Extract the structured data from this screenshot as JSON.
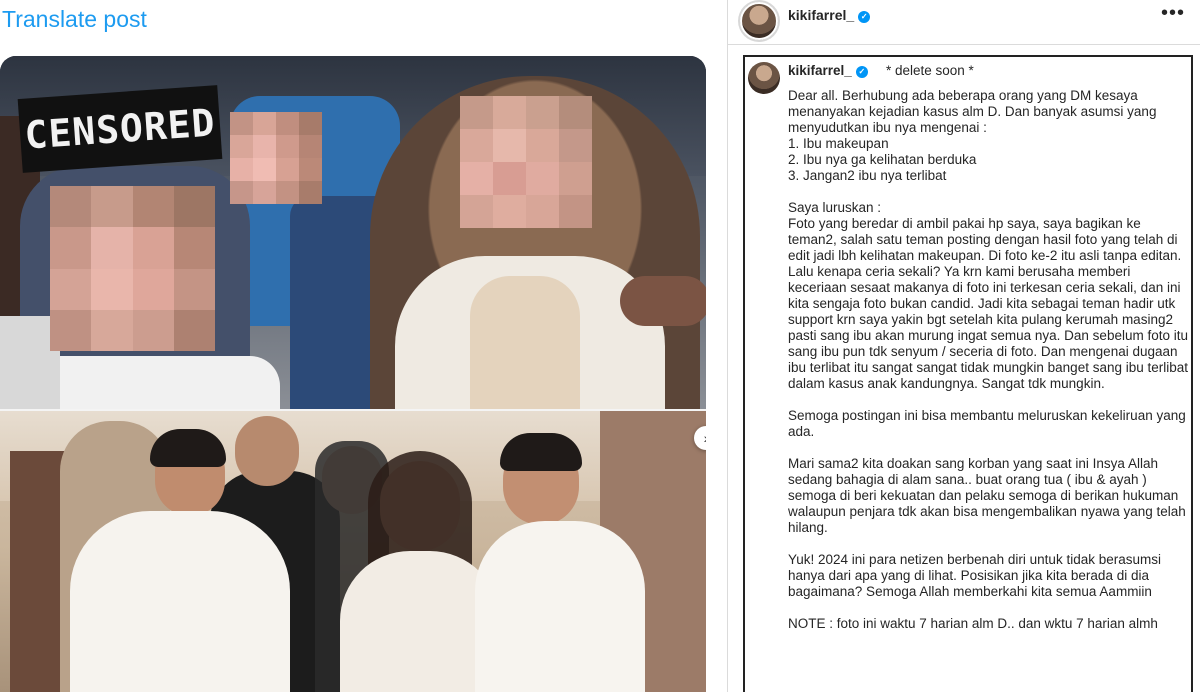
{
  "left": {
    "translate_label": "Translate post",
    "censored_text": "CENSORED",
    "carousel_next_glyph": "›"
  },
  "right": {
    "header": {
      "username": "kikifarrel_",
      "verified_glyph": "✓",
      "more_glyph": "•••"
    },
    "caption": {
      "username": "kikifarrel_",
      "verified_glyph": "✓",
      "title": "* delete soon *",
      "greeting": "Dear all. Berhubung ada beberapa orang yang DM kesaya menanyakan kejadian kasus alm D. Dan banyak asumsi yang menyudutkan ibu nya mengenai :",
      "list": [
        "1. Ibu makeupan",
        "2. Ibu nya ga kelihatan berduka",
        "3. Jangan2 ibu nya terlibat"
      ],
      "clarify_heading": "Saya luruskan :",
      "clarify_body": "Foto yang beredar di ambil pakai hp saya, saya bagikan ke teman2, salah satu teman posting dengan hasil foto yang telah di edit jadi lbh kelihatan makeupan. Di foto ke-2 itu asli tanpa editan. Lalu kenapa ceria sekali? Ya krn kami berusaha memberi keceriaan sesaat makanya di foto ini terkesan ceria sekali, dan ini kita sengaja foto bukan candid. Jadi kita sebagai teman hadir utk support krn saya yakin bgt setelah kita pulang kerumah masing2 pasti sang ibu akan murung ingat semua nya. Dan sebelum foto itu sang ibu pun tdk senyum / seceria di foto. Dan mengenai dugaan ibu terlibat itu sangat sangat tidak mungkin banget sang ibu terlibat dalam kasus anak kandungnya. Sangat tdk mungkin.",
      "hope": "Semoga postingan ini bisa membantu meluruskan kekeliruan yang ada.",
      "pray": "Mari sama2 kita doakan sang korban yang saat ini Insya Allah sedang bahagia di alam sana.. buat orang tua ( ibu & ayah ) semoga di beri kekuatan dan pelaku semoga di berikan hukuman walaupun penjara tdk akan bisa mengembalikan nyawa yang telah hilang.",
      "closing": "Yuk! 2024 ini para netizen berbenah diri untuk tidak berasumsi hanya dari apa yang di lihat. Posisikan jika kita berada di dia bagaimana? Semoga Allah memberkahi kita semua Aammiin",
      "note": "NOTE : foto ini waktu 7 harian alm D.. dan wktu 7 harian almh"
    }
  },
  "colors": {
    "link_blue": "#1d9bf0",
    "verified_blue": "#0095f6",
    "border": "#dbdbdb",
    "text": "#262626"
  },
  "icons": [
    "verified-badge-icon",
    "more-options-icon",
    "chevron-right-icon"
  ]
}
